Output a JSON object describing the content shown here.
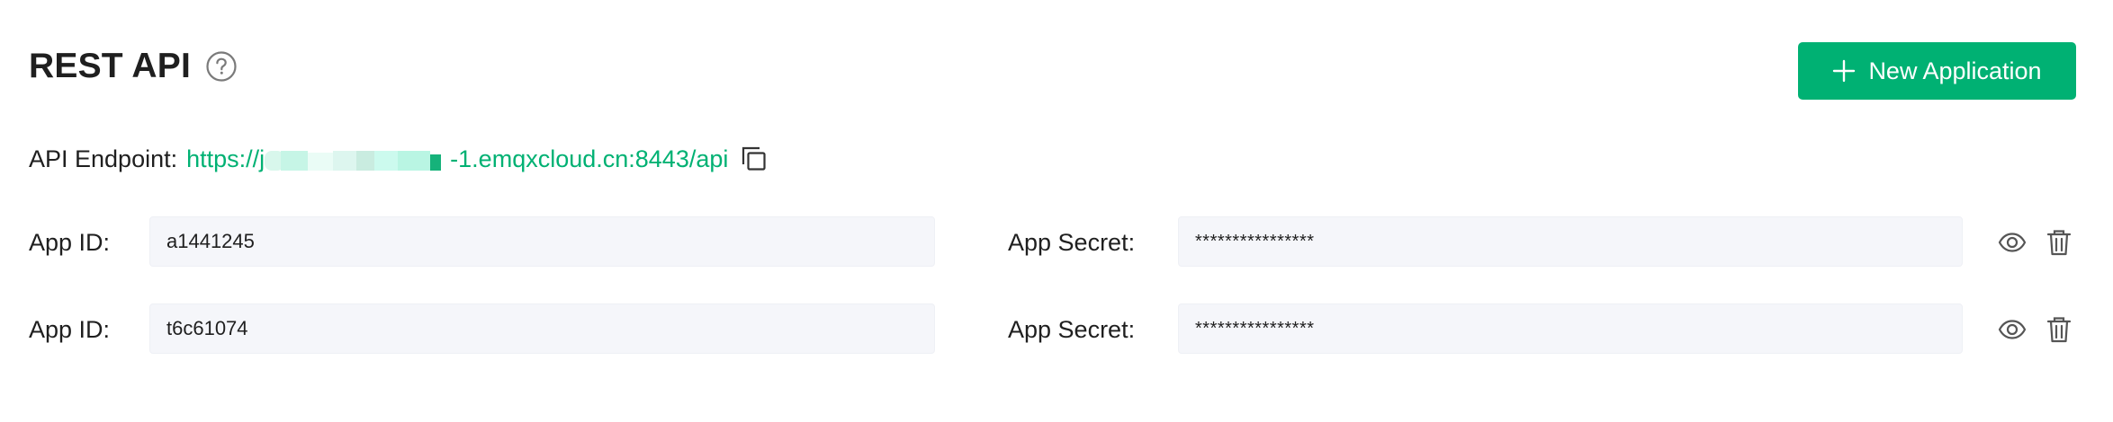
{
  "header": {
    "title": "REST API",
    "help_icon": "question-circle-icon",
    "new_button_label": "New Application",
    "new_button_icon": "plus-icon"
  },
  "endpoint": {
    "label": "API Endpoint:",
    "url_prefix": "https://j",
    "url_suffix": "-1.emqxcloud.cn:8443/api",
    "copy_icon": "copy-icon"
  },
  "credentials": [
    {
      "app_id_label": "App ID:",
      "app_id": "a1441245",
      "secret_label": "App Secret:",
      "secret": "****************"
    },
    {
      "app_id_label": "App ID:",
      "app_id": "t6c61074",
      "secret_label": "App Secret:",
      "secret": "****************"
    }
  ],
  "colors": {
    "accent": "#00b173",
    "text": "#1f1f1f",
    "field_bg": "#f5f6fa",
    "icon": "#555555"
  }
}
